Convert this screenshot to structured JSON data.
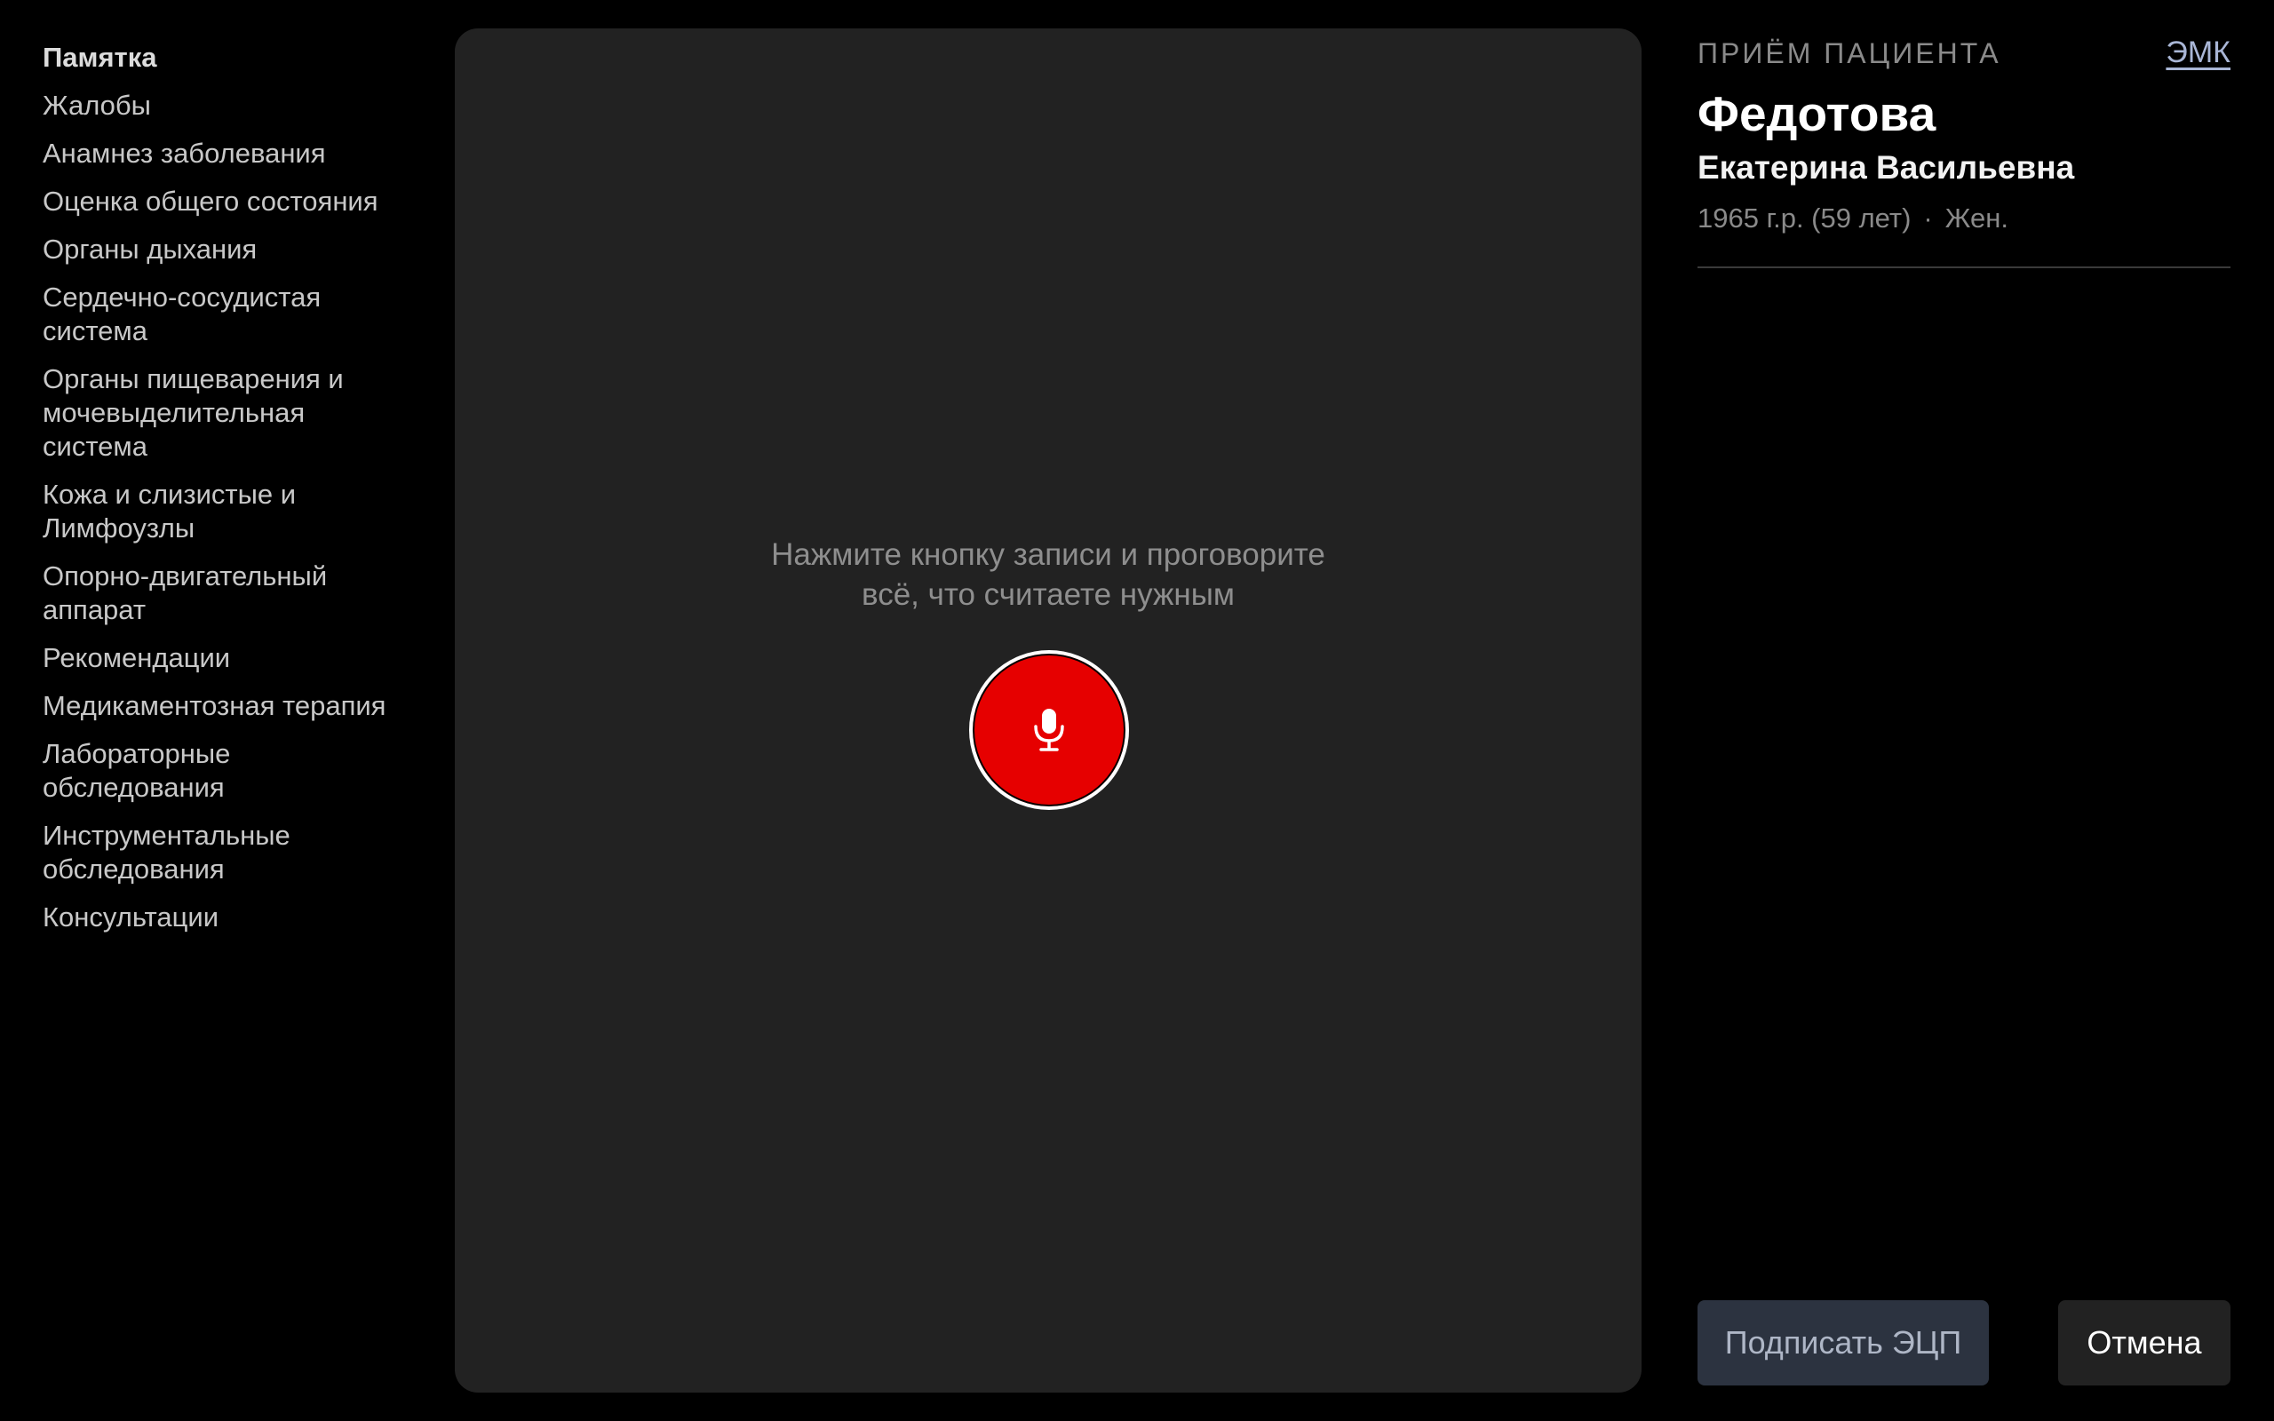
{
  "sidebar": {
    "items": [
      {
        "label": "Памятка"
      },
      {
        "label": "Жалобы"
      },
      {
        "label": "Анамнез заболевания"
      },
      {
        "label": "Оценка общего состояния"
      },
      {
        "label": "Органы дыхания"
      },
      {
        "label": "Сердечно-сосудистая система"
      },
      {
        "label": "Органы пищеварения и мочевыделительная система"
      },
      {
        "label": "Кожа и слизистые и Лимфоузлы"
      },
      {
        "label": "Опорно-двигательный аппарат"
      },
      {
        "label": "Рекомендации"
      },
      {
        "label": "Медикаментозная терапия"
      },
      {
        "label": "Лабораторные обследования"
      },
      {
        "label": "Инструментальные обследования"
      },
      {
        "label": "Консультации"
      }
    ],
    "active_index": 0
  },
  "recorder": {
    "prompt_line1": "Нажмите кнопку записи и проговорите",
    "prompt_line2": "всё, что считаете нужным",
    "button_icon": "microphone-icon",
    "button_color": "#e60000"
  },
  "patient": {
    "section_title": "ПРИЁМ ПАЦИЕНТА",
    "emk_link": "ЭМК",
    "surname": "Федотова",
    "given_name": "Екатерина Васильевна",
    "birth_info": "1965 г.р. (59 лет)",
    "separator": "·",
    "sex": "Жен."
  },
  "actions": {
    "sign_label": "Подписать ЭЦП",
    "cancel_label": "Отмена"
  },
  "colors": {
    "background": "#000000",
    "panel": "#222222",
    "accent_red": "#e60000",
    "link": "#a9b6d6",
    "sign_button_bg": "#2c3340"
  }
}
